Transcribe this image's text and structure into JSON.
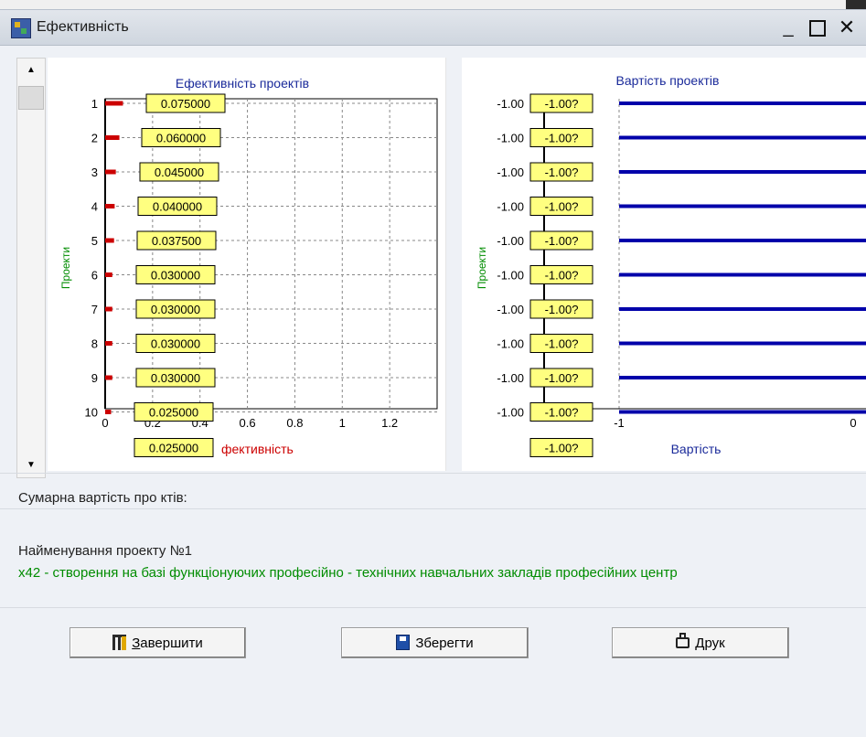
{
  "window": {
    "title": "Ефективність",
    "min_label": "_",
    "close_label": "✕"
  },
  "efficiency_chart": {
    "title": "Ефективність проектів",
    "ylabel": "Проекти",
    "xlabel": "Ефективність",
    "xlabel_visible": "фективність",
    "x_ticks": [
      "0",
      "0.2",
      "0.4",
      "0.6",
      "0.8",
      "1",
      "1.2"
    ],
    "y_ticks": [
      "1",
      "2",
      "3",
      "4",
      "5",
      "6",
      "7",
      "8",
      "9",
      "10"
    ],
    "data_labels": [
      "0.075000",
      "0.060000",
      "0.045000",
      "0.040000",
      "0.037500",
      "0.030000",
      "0.030000",
      "0.030000",
      "0.030000",
      "0.025000",
      "0.025000"
    ]
  },
  "cost_chart": {
    "title": "Вартість проектів",
    "ylabel": "Проекти",
    "xlabel": "Вартість",
    "x_ticks": [
      "-1",
      "0"
    ],
    "y_ticks": [
      "-1.00",
      "-1.00",
      "-1.00",
      "-1.00",
      "-1.00",
      "-1.00",
      "-1.00",
      "-1.00",
      "-1.00",
      "-1.00"
    ],
    "data_labels": [
      "-1.00?",
      "-1.00?",
      "-1.00?",
      "-1.00?",
      "-1.00?",
      "-1.00?",
      "-1.00?",
      "-1.00?",
      "-1.00?",
      "-1.00?",
      "-1.00?"
    ]
  },
  "chart_data": [
    {
      "type": "bar",
      "title": "Ефективність проектів",
      "xlabel": "Ефективність",
      "ylabel": "Проекти",
      "categories": [
        "1",
        "2",
        "3",
        "4",
        "5",
        "6",
        "7",
        "8",
        "9",
        "10"
      ],
      "values": [
        0.075,
        0.06,
        0.045,
        0.04,
        0.0375,
        0.03,
        0.03,
        0.03,
        0.03,
        0.025
      ],
      "xlim": [
        0,
        1.4
      ],
      "grid": true,
      "color": "#cc0000"
    },
    {
      "type": "bar",
      "title": "Вартість проектів",
      "xlabel": "Вартість",
      "ylabel": "Проекти",
      "categories": [
        "-1.00",
        "-1.00",
        "-1.00",
        "-1.00",
        "-1.00",
        "-1.00",
        "-1.00",
        "-1.00",
        "-1.00",
        "-1.00"
      ],
      "values": [
        -1,
        -1,
        -1,
        -1,
        -1,
        -1,
        -1,
        -1,
        -1,
        -1
      ],
      "xlim": [
        -1,
        0
      ],
      "grid": true,
      "color": "#0000aa"
    }
  ],
  "summary": {
    "label": "Сумарна вартість про ктів:"
  },
  "project": {
    "title": "Найменування проекту №1",
    "description": "x42 - створення на базі функціонуючих професійно - технічних навчальних закладів професійних центр"
  },
  "buttons": {
    "finish_key": "З",
    "finish_rest": "авершити",
    "save": "Зберегти",
    "print": "Друк"
  }
}
